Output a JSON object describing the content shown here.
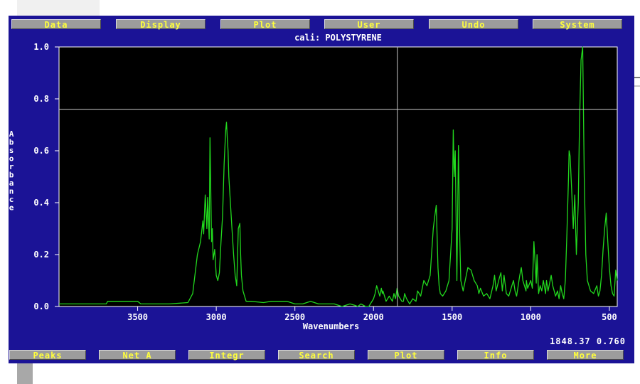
{
  "menu": {
    "top": [
      "Data",
      "Display",
      "Plot",
      "User",
      "Undo",
      "System"
    ],
    "bottom": [
      "Peaks",
      "Net A",
      "Integr",
      "Search",
      "Plot",
      "Info",
      "More"
    ]
  },
  "colors": {
    "background": "#1b1396",
    "plot_area": "#000000",
    "trace": "#22d81e",
    "button_face": "#9c9c9c",
    "button_text": "#ffff3c",
    "cursor": "#c8c8c8"
  },
  "cursor_readout": "1848.37  0.760",
  "chart_data": {
    "type": "line",
    "title": "cali: POLYSTYRENE",
    "xlabel": "Wavenumbers",
    "ylabel": "Absorbance",
    "xlim": [
      4000,
      450
    ],
    "ylim": [
      0.0,
      1.0
    ],
    "x_ticks": [
      "3500",
      "3000",
      "2500",
      "2000",
      "1500",
      "1000",
      "500"
    ],
    "y_ticks": [
      "0.0",
      "0.2",
      "0.4",
      "0.6",
      "0.8",
      "1.0"
    ],
    "cursor": {
      "x": 1848.37,
      "y": 0.76
    },
    "grid": false,
    "series": [
      {
        "x": [
          4000,
          3700,
          3690,
          3500,
          3480,
          3300,
          3180,
          3150,
          3120,
          3100,
          3085,
          3080,
          3070,
          3060,
          3055,
          3045,
          3040,
          3030,
          3025,
          3020,
          3010,
          3000,
          2990,
          2980,
          2970,
          2960,
          2950,
          2940,
          2935,
          2930,
          2925,
          2920,
          2910,
          2900,
          2890,
          2880,
          2870,
          2860,
          2850,
          2845,
          2840,
          2830,
          2820,
          2810,
          2780,
          2700,
          2650,
          2550,
          2500,
          2450,
          2400,
          2350,
          2300,
          2250,
          2200,
          2150,
          2120,
          2100,
          2080,
          2050,
          2030,
          2000,
          1990,
          1980,
          1960,
          1950,
          1944,
          1940,
          1920,
          1900,
          1880,
          1870,
          1860,
          1850,
          1840,
          1820,
          1810,
          1802,
          1790,
          1770,
          1750,
          1730,
          1720,
          1700,
          1680,
          1660,
          1640,
          1620,
          1610,
          1601,
          1590,
          1583,
          1575,
          1560,
          1540,
          1520,
          1500,
          1493,
          1487,
          1480,
          1470,
          1460,
          1452,
          1445,
          1430,
          1420,
          1400,
          1380,
          1370,
          1360,
          1340,
          1330,
          1320,
          1300,
          1280,
          1260,
          1240,
          1230,
          1220,
          1200,
          1190,
          1181,
          1170,
          1155,
          1140,
          1120,
          1110,
          1100,
          1090,
          1080,
          1070,
          1060,
          1050,
          1040,
          1030,
          1028,
          1020,
          1000,
          990,
          980,
          965,
          960,
          950,
          940,
          930,
          920,
          906,
          900,
          890,
          870,
          860,
          842,
          830,
          820,
          810,
          800,
          790,
          780,
          770,
          760,
          756,
          750,
          740,
          730,
          720,
          710,
          698,
          690,
          680,
          670,
          660,
          650,
          640,
          620,
          600,
          580,
          570,
          560,
          550,
          540,
          530,
          520,
          510,
          500,
          490,
          480,
          470,
          460,
          450
        ],
        "y": [
          0.01,
          0.01,
          0.02,
          0.02,
          0.01,
          0.01,
          0.015,
          0.05,
          0.2,
          0.25,
          0.33,
          0.28,
          0.43,
          0.3,
          0.42,
          0.26,
          0.65,
          0.25,
          0.3,
          0.18,
          0.22,
          0.12,
          0.1,
          0.13,
          0.25,
          0.35,
          0.55,
          0.68,
          0.71,
          0.65,
          0.6,
          0.5,
          0.4,
          0.3,
          0.2,
          0.12,
          0.08,
          0.3,
          0.32,
          0.2,
          0.12,
          0.06,
          0.04,
          0.02,
          0.02,
          0.015,
          0.02,
          0.02,
          0.01,
          0.01,
          0.02,
          0.01,
          0.01,
          0.01,
          0.0,
          0.01,
          0.005,
          0.0,
          0.01,
          0.0,
          0.0,
          0.03,
          0.05,
          0.08,
          0.04,
          0.07,
          0.05,
          0.06,
          0.02,
          0.04,
          0.02,
          0.05,
          0.03,
          0.07,
          0.04,
          0.02,
          0.02,
          0.05,
          0.03,
          0.01,
          0.03,
          0.02,
          0.06,
          0.04,
          0.1,
          0.08,
          0.12,
          0.3,
          0.35,
          0.39,
          0.15,
          0.08,
          0.05,
          0.04,
          0.06,
          0.1,
          0.3,
          0.68,
          0.5,
          0.6,
          0.1,
          0.62,
          0.28,
          0.1,
          0.06,
          0.09,
          0.15,
          0.14,
          0.12,
          0.1,
          0.08,
          0.05,
          0.07,
          0.04,
          0.05,
          0.03,
          0.08,
          0.12,
          0.06,
          0.11,
          0.13,
          0.06,
          0.12,
          0.05,
          0.04,
          0.08,
          0.1,
          0.06,
          0.04,
          0.08,
          0.12,
          0.15,
          0.1,
          0.08,
          0.06,
          0.1,
          0.07,
          0.1,
          0.07,
          0.25,
          0.09,
          0.2,
          0.05,
          0.08,
          0.06,
          0.1,
          0.05,
          0.1,
          0.06,
          0.12,
          0.08,
          0.04,
          0.06,
          0.03,
          0.08,
          0.05,
          0.03,
          0.1,
          0.28,
          0.5,
          0.6,
          0.58,
          0.45,
          0.3,
          0.43,
          0.2,
          0.4,
          0.7,
          0.95,
          1.0,
          0.5,
          0.2,
          0.1,
          0.06,
          0.05,
          0.08,
          0.04,
          0.06,
          0.12,
          0.22,
          0.3,
          0.36,
          0.25,
          0.15,
          0.08,
          0.05,
          0.04,
          0.14,
          0.1
        ]
      }
    ]
  }
}
